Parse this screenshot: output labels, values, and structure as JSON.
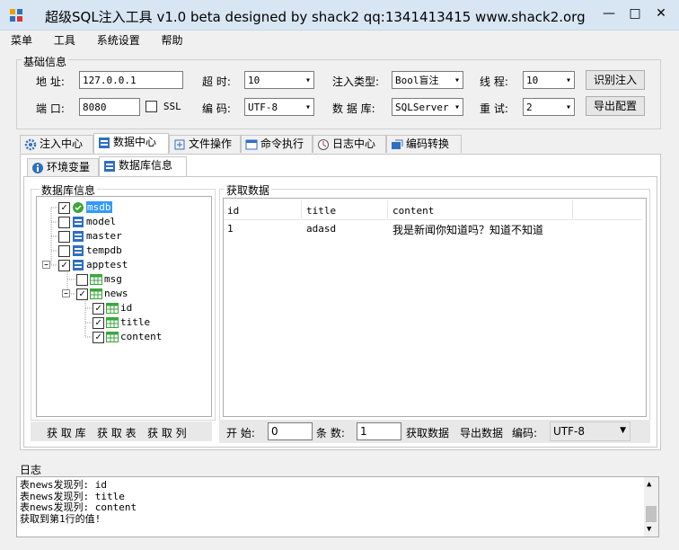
{
  "window": {
    "title": "超级SQL注入工具 v1.0 beta designed by shack2 qq:1341413415 www.shack2.org",
    "minimize": "—",
    "maximize": "□",
    "close": "✕"
  },
  "menu": [
    "菜单",
    "工具",
    "系统设置",
    "帮助"
  ],
  "basic": {
    "legend": "基础信息",
    "address_label": "地  址:",
    "address_value": "127.0.0.1",
    "port_label": "端  口:",
    "port_value": "8080",
    "ssl_label": "SSL",
    "timeout_label": "超  时:",
    "timeout_value": "10",
    "encoding_label": "编  码:",
    "encoding_value": "UTF-8",
    "inject_type_label": "注入类型:",
    "inject_type_value": "Bool盲注",
    "db_label": "数 据 库:",
    "db_value": "SQLServer",
    "threads_label": "线  程:",
    "threads_value": "10",
    "retry_label": "重  试:",
    "retry_value": "2",
    "detect_button": "识别注入",
    "export_button": "导出配置"
  },
  "tabs": [
    {
      "label": "注入中心",
      "icon": "gear-icon"
    },
    {
      "label": "数据中心",
      "icon": "database-icon"
    },
    {
      "label": "文件操作",
      "icon": "file-move-icon"
    },
    {
      "label": "命令执行",
      "icon": "window-icon"
    },
    {
      "label": "日志中心",
      "icon": "clock-icon"
    },
    {
      "label": "编码转换",
      "icon": "convert-icon"
    }
  ],
  "subtabs": [
    {
      "label": "环境变量",
      "icon": "info-icon"
    },
    {
      "label": "数据库信息",
      "icon": "database-icon"
    }
  ],
  "dbinfo": {
    "legend": "数据库信息",
    "tree": [
      {
        "name": "msdb",
        "checked": true,
        "level": 0,
        "kind": "db",
        "selected": true
      },
      {
        "name": "model",
        "checked": false,
        "level": 0,
        "kind": "db"
      },
      {
        "name": "master",
        "checked": false,
        "level": 0,
        "kind": "db"
      },
      {
        "name": "tempdb",
        "checked": false,
        "level": 0,
        "kind": "db"
      },
      {
        "name": "apptest",
        "checked": true,
        "level": 0,
        "kind": "db",
        "expanded": true
      },
      {
        "name": "msg",
        "checked": false,
        "level": 1,
        "kind": "table"
      },
      {
        "name": "news",
        "checked": true,
        "level": 1,
        "kind": "table",
        "expanded": true
      },
      {
        "name": "id",
        "checked": true,
        "level": 2,
        "kind": "column"
      },
      {
        "name": "title",
        "checked": true,
        "level": 2,
        "kind": "column"
      },
      {
        "name": "content",
        "checked": true,
        "level": 2,
        "kind": "column"
      }
    ],
    "buttons": [
      "获 取 库",
      "获 取 表",
      "获 取 列"
    ]
  },
  "fetch": {
    "legend": "获取数据",
    "columns": [
      "id",
      "title",
      "content"
    ],
    "rows": [
      [
        "1",
        "adasd",
        "我是新闻你知道吗？知道不知道"
      ]
    ],
    "start_label": "开 始:",
    "start_value": "0",
    "count_label": "条 数:",
    "count_value": "1",
    "fetch_button": "获取数据",
    "export_button": "导出数据",
    "encoding_label": "编码:",
    "encoding_value": "UTF-8"
  },
  "log": {
    "legend": "日志",
    "lines": [
      "表news发现列: id",
      "表news发现列: title",
      "表news发现列: content",
      "获取到第1行的值!"
    ]
  },
  "colors": {
    "selection": "#3399ff",
    "green": "#3aa63a",
    "db_blue": "#2f6fc1"
  }
}
